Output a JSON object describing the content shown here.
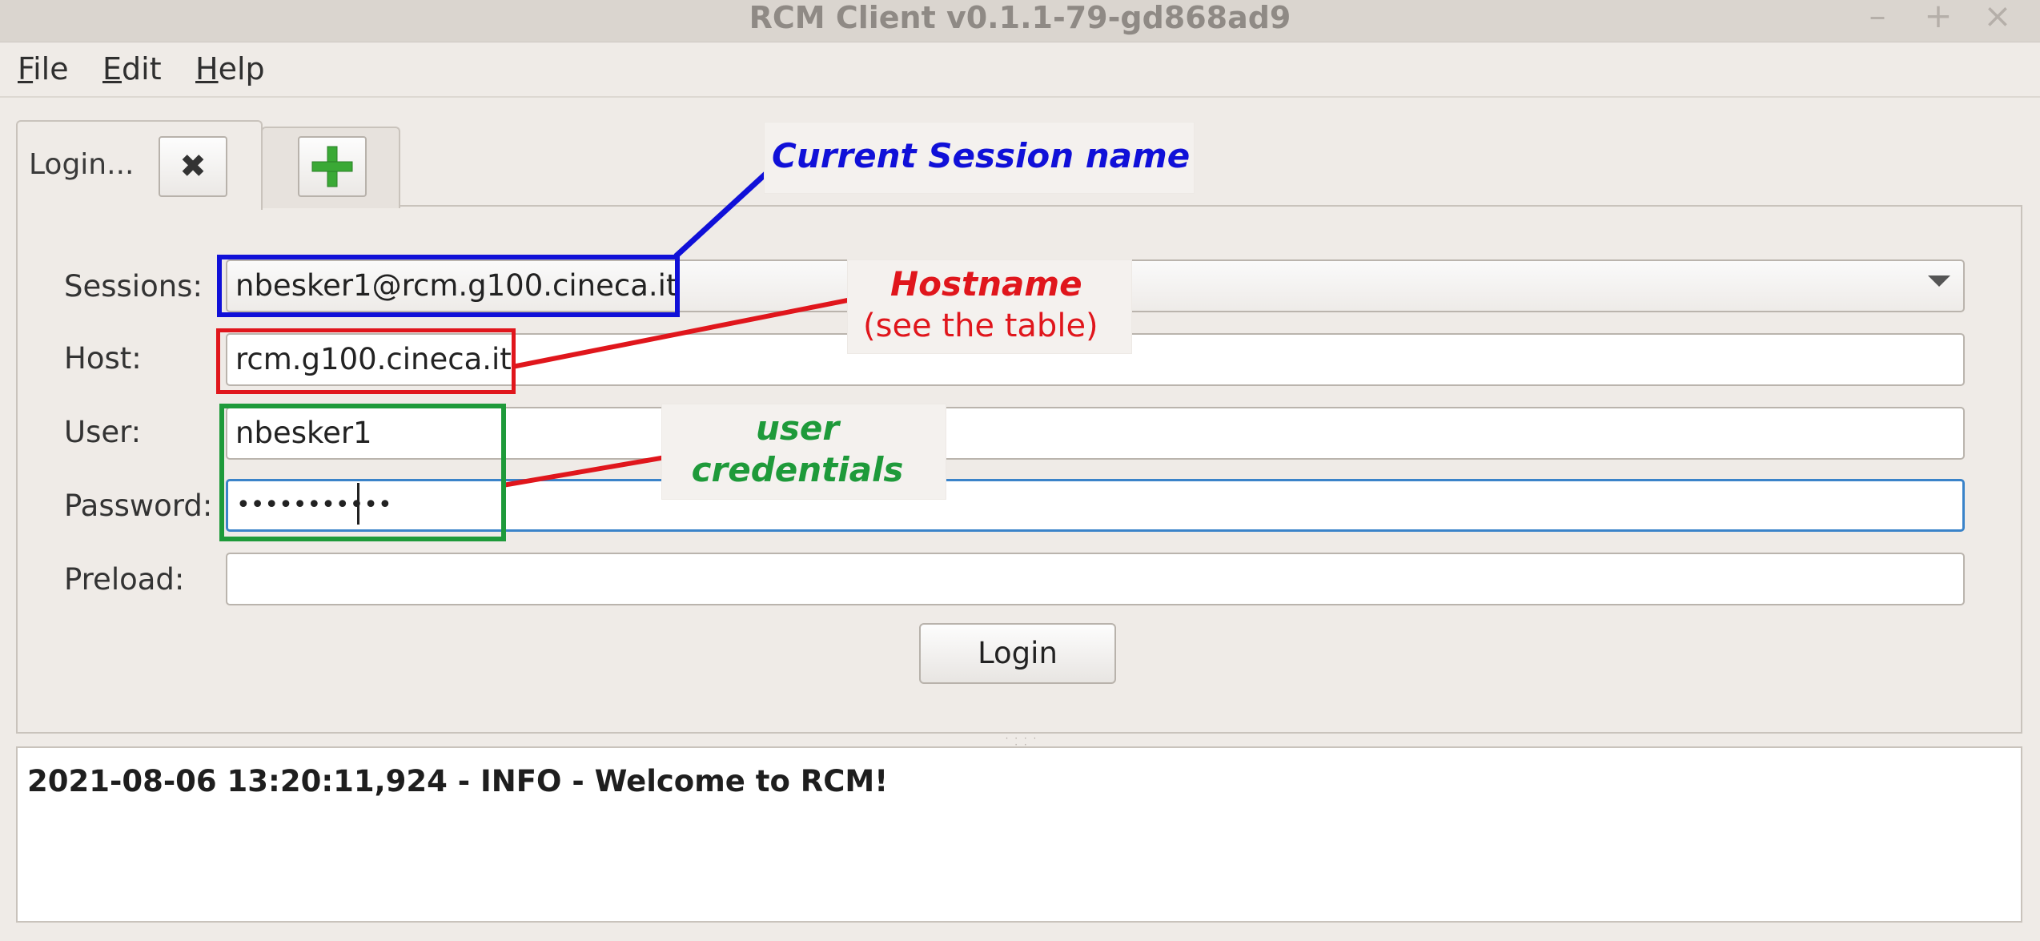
{
  "window": {
    "title": "RCM Client v0.1.1-79-gd868ad9",
    "minimize_glyph": "–",
    "maximize_glyph": "+",
    "close_glyph": "×"
  },
  "menubar": {
    "file": {
      "mnemonic": "F",
      "rest": "ile"
    },
    "edit": {
      "mnemonic": "E",
      "rest": "dit"
    },
    "help": {
      "mnemonic": "H",
      "rest": "elp"
    }
  },
  "tabs": {
    "login_label": "Login...",
    "close_glyph": "✖",
    "add_icon": "plus-icon"
  },
  "form": {
    "sessions_label": "Sessions:",
    "sessions_value": "nbesker1@rcm.g100.cineca.it",
    "host_label": "Host:",
    "host_value": "rcm.g100.cineca.it",
    "user_label": "User:",
    "user_value": "nbesker1",
    "password_label": "Password:",
    "password_value": "•••••••••••",
    "preload_label": "Preload:",
    "preload_value": "",
    "login_button": "Login"
  },
  "log": {
    "line": "2021-08-06 13:20:11,924 - INFO - Welcome to RCM!"
  },
  "annotations": {
    "session_name": "Current Session name",
    "hostname": "Hostname",
    "hostname_sub": "(see the table)",
    "credentials_line1": "user",
    "credentials_line2": "credentials"
  },
  "colors": {
    "annotation_blue": "#1010d8",
    "annotation_red": "#e0161c",
    "annotation_green": "#1e9a3a",
    "focus_border": "#3a83c9",
    "plus_green": "#3aa935"
  }
}
